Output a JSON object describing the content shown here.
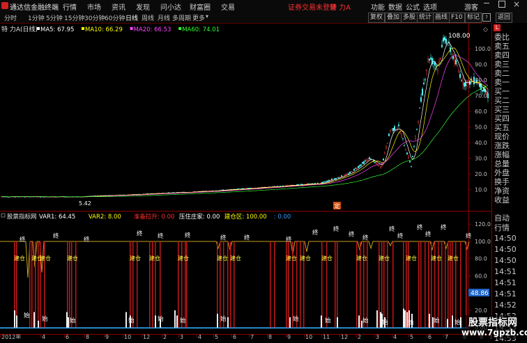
{
  "app": {
    "title": "通达信金融终端",
    "menu": [
      "行情",
      "市场",
      "资讯",
      "发现",
      "问小达",
      "财富圈",
      "交易"
    ],
    "alert": "证券交易未登录",
    "stock": "特 力A",
    "right_menu": [
      "功能",
      "数据",
      "公式",
      "选项",
      "游客"
    ]
  },
  "toolbar": {
    "periods": [
      "分时",
      "1分钟",
      "5分钟",
      "15分钟",
      "30分钟",
      "60分钟",
      "日线",
      "周线",
      "月线",
      "多周期",
      "更多"
    ],
    "active_period": "日线",
    "buttons": [
      "复权",
      "叠加",
      "多股",
      "统计",
      "画线",
      "F10",
      "标记",
      "返回"
    ]
  },
  "main_chart": {
    "header_name": "特 力A(日线)",
    "ma": [
      {
        "label": "MA5: 67.95",
        "color": "#ffffff"
      },
      {
        "label": "MA10: 66.29",
        "color": "#ffff00"
      },
      {
        "label": "MA20: 66.53",
        "color": "#ff44ff"
      },
      {
        "label": "MA60: 74.01",
        "color": "#33ff33"
      }
    ],
    "y_ticks": [
      "100.0",
      "90.0",
      "80.0",
      "70.0",
      "60.0",
      "50.0",
      "40.0",
      "30.0",
      "20.0",
      "10.0"
    ],
    "y_range": [
      0,
      113
    ],
    "high_label": "108.00",
    "low_label": "5.42",
    "marker": "定"
  },
  "indicator": {
    "name": "股票指标网",
    "labels": [
      {
        "text": "VAR1: 64.45",
        "color": "#ffffff"
      },
      {
        "text": "VAR2: 8.00",
        "color": "#ffff00"
      },
      {
        "text": "准备拉升: 0.00",
        "color": "#ff3030"
      },
      {
        "text": "压住庄家: 0.00",
        "color": "#ffffff"
      },
      {
        "text": "建仓区: 100.00",
        "color": "#ffff00"
      },
      {
        "text": ": 0.00",
        "color": "#3399ff"
      }
    ],
    "y_ticks": [
      "120.0",
      "100.0",
      "80.0",
      "60.0",
      "40.0",
      "20.0",
      "0.00"
    ],
    "y_range": [
      -5,
      125
    ],
    "current_value": "48.86",
    "tag_end": "终",
    "tag_build": "建仓",
    "tag_start": "始"
  },
  "x_axis": {
    "labels": [
      "2012年",
      "4",
      "6",
      "8",
      "9",
      "10",
      "12",
      "2",
      "3",
      "4",
      "5",
      "6",
      "7",
      "8",
      "9",
      "10",
      "11",
      "12",
      "2",
      "3",
      "4",
      "5",
      "6",
      "7",
      "8",
      "9",
      "10",
      "12"
    ]
  },
  "right_panel": {
    "items": [
      "委比",
      "卖五",
      "卖四",
      "卖三",
      "卖二",
      "卖一",
      "买一",
      "买二",
      "买三",
      "买四",
      "买五",
      "现价",
      "涨跌",
      "涨幅",
      "总量",
      "外盘",
      "换手",
      "净资",
      "收益"
    ],
    "bottom_items": [
      "自动",
      "行情"
    ],
    "times": [
      "14:50",
      "14:50",
      "14:50",
      "14:51",
      "14:51",
      "14:51",
      "14:52",
      "14:52",
      "14:53",
      "14:53"
    ]
  },
  "watermark": {
    "line1": "股票指标网",
    "line2": "www.7gpzb.com"
  }
}
